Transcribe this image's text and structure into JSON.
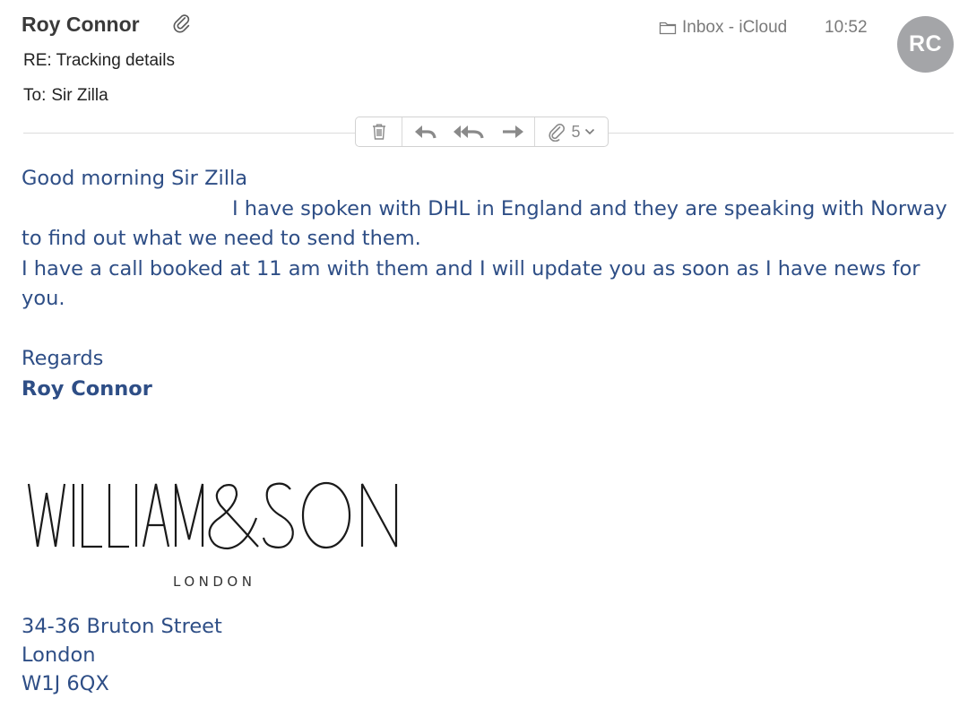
{
  "header": {
    "sender": "Roy Connor",
    "subject": "RE: Tracking details",
    "to_label": "To:",
    "to_name": "Sir Zilla",
    "mailbox": "Inbox - iCloud",
    "time": "10:52",
    "avatar_initials": "RC",
    "attachment_icon": "paperclip-icon"
  },
  "toolbar": {
    "icons": [
      "trash-icon",
      "reply-icon",
      "reply-all-icon",
      "forward-icon",
      "paperclip-icon",
      "chevron-down-icon"
    ],
    "attachment_count": "5"
  },
  "body": {
    "greeting": "Good morning  Sir Zilla",
    "para1_line1": "I have spoken with DHL in England and they are speaking with Norway",
    "para1_line2": "to find out what we need to send them.",
    "para2_line1": "I have a call booked at 11 am with them and I will update you as soon as I have news for",
    "para2_line2": "you.",
    "closing": "Regards",
    "signature_name": "Roy Connor"
  },
  "logo": {
    "brand": "WILLIAM&SON",
    "city": "LONDON"
  },
  "address": {
    "line1": "34-36 Bruton Street",
    "line2": "London",
    "line3": "W1J 6QX"
  },
  "colors": {
    "body_text": "#2e4e86",
    "avatar_bg": "#a4a5a8",
    "meta_gray": "#7a7a7a"
  }
}
